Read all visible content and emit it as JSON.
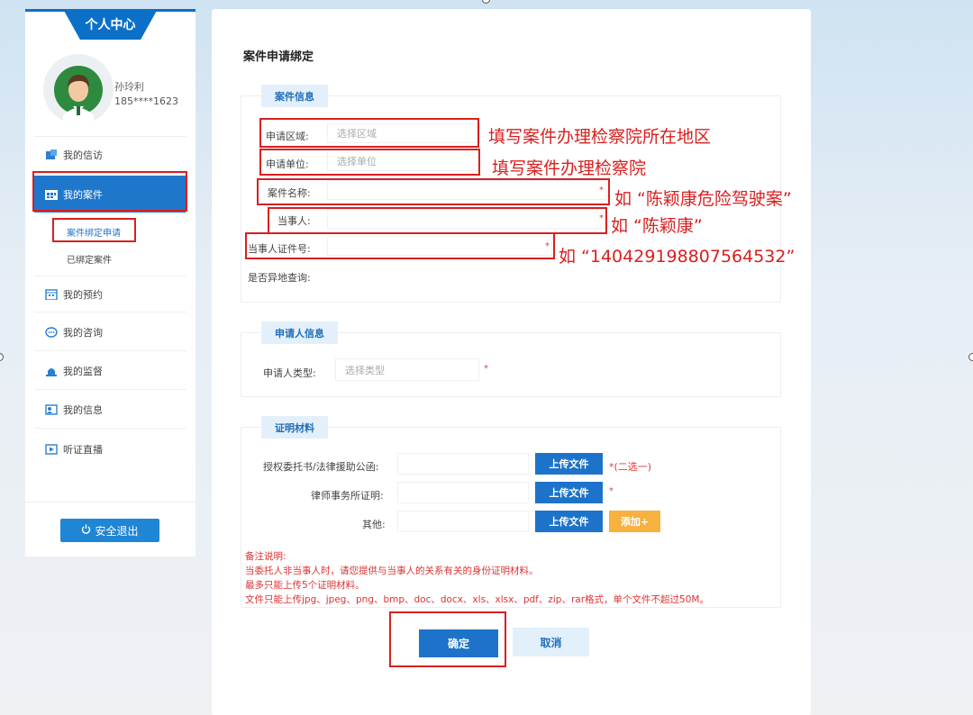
{
  "sidebar": {
    "title": "个人中心",
    "user_name": "孙玲利",
    "user_phone": "185****1623",
    "menu": [
      {
        "label": "我的信访",
        "icon": "envelope-icon"
      },
      {
        "label": "我的案件",
        "icon": "case-icon"
      },
      {
        "label": "我的预约",
        "icon": "calendar-icon"
      },
      {
        "label": "我的咨询",
        "icon": "chat-icon"
      },
      {
        "label": "我的监督",
        "icon": "alarm-icon"
      },
      {
        "label": "我的信息",
        "icon": "profile-icon"
      },
      {
        "label": "听证直播",
        "icon": "play-icon"
      }
    ],
    "submenu": [
      "案件绑定申请",
      "已绑定案件"
    ],
    "logout_label": "安全退出"
  },
  "main": {
    "title": "案件申请绑定",
    "case_section": {
      "tab": "案件信息",
      "fields": [
        {
          "label": "申请区域:",
          "placeholder": "选择区域"
        },
        {
          "label": "申请单位:",
          "placeholder": "选择单位"
        },
        {
          "label": "案件名称:",
          "placeholder": ""
        },
        {
          "label": "当事人:",
          "placeholder": ""
        },
        {
          "label": "当事人证件号:",
          "placeholder": ""
        }
      ],
      "remote_label": "是否异地查询:"
    },
    "applicant_section": {
      "tab": "申请人信息",
      "type_label": "申请人类型:",
      "type_placeholder": "选择类型"
    },
    "proof_section": {
      "tab": "证明材料",
      "rows": [
        {
          "label": "授权委托书/法律援助公函:",
          "button": "上传文件",
          "note": "*(二选一)"
        },
        {
          "label": "律师事务所证明:",
          "button": "上传文件",
          "note": "*"
        },
        {
          "label": "其他:",
          "button": "上传文件",
          "note": ""
        }
      ],
      "add_button": "添加+",
      "notes": [
        "备注说明:",
        "当委托人非当事人时，请您提供与当事人的关系有关的身份证明材料。",
        "最多只能上传5个证明材料。",
        "文件只能上传jpg、jpeg、png、bmp、doc、docx、xls、xlsx、pdf、zip、rar格式，单个文件不超过50M。"
      ]
    },
    "confirm_button": "确定",
    "cancel_button": "取消"
  },
  "annotations": [
    "填写案件办理检察院所在地区",
    "填写案件办理检察院",
    "如 “陈颖康危险驾驶案”",
    "如 “陈颖康”",
    "如 “140429198807564532”"
  ],
  "colors": {
    "primary": "#1d73c9",
    "annotation": "#d91f1f",
    "accent_orange": "#f6b13e"
  }
}
